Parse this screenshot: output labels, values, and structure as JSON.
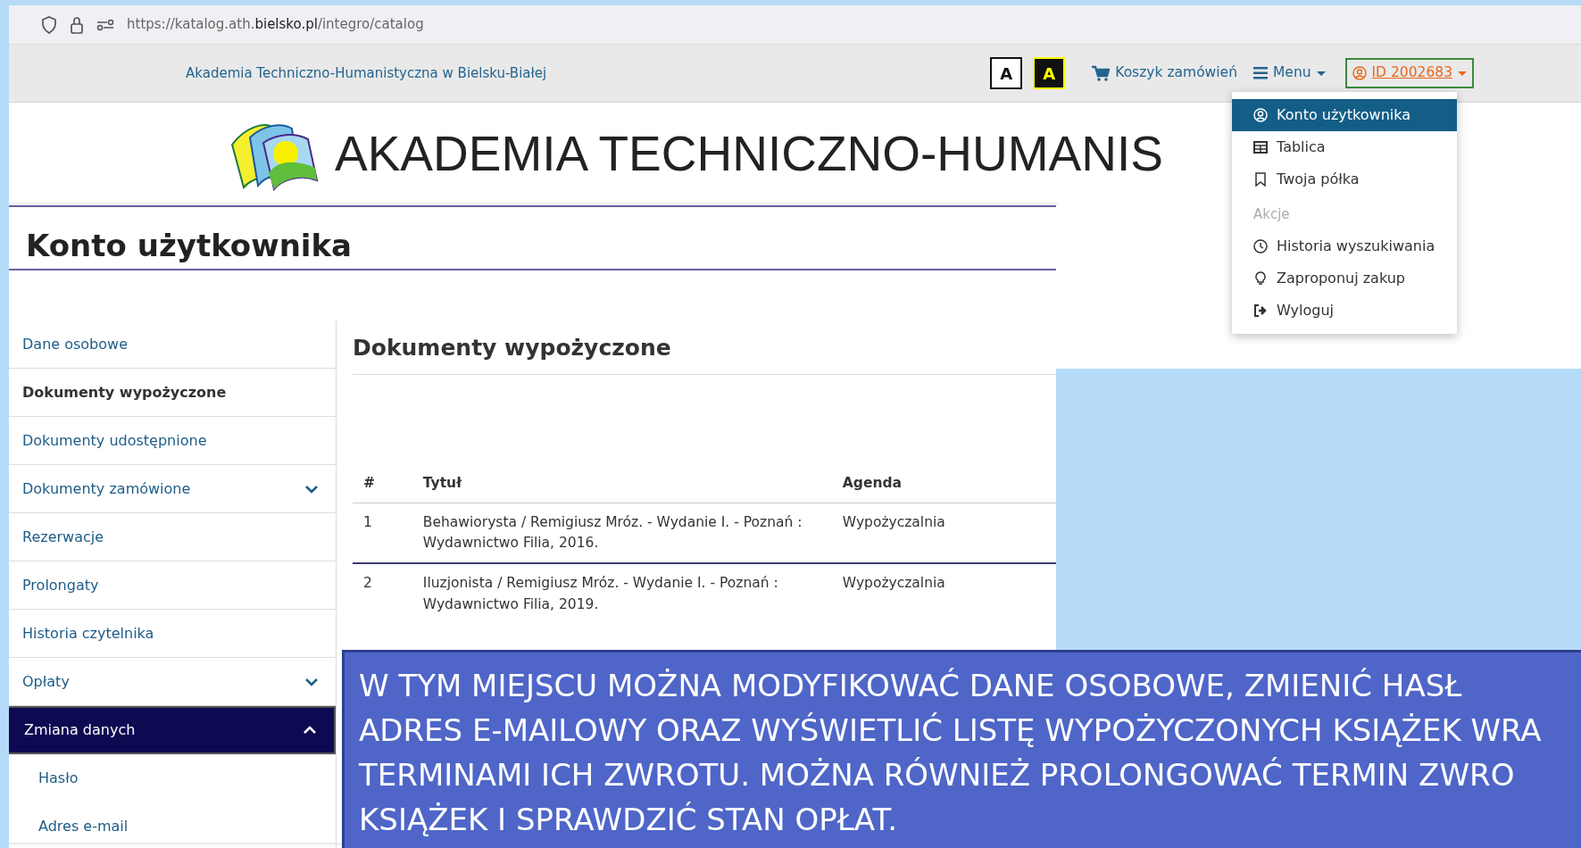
{
  "browser": {
    "url_parts": [
      "https://katalog.ath.",
      "bielsko.pl",
      "/integro/catalog"
    ]
  },
  "navbar": {
    "institution": "Akademia Techniczno-Humanistyczna w Bielsku-Białej",
    "contrast_buttons": [
      {
        "label": "A",
        "kind": "normal"
      },
      {
        "label": "A",
        "kind": "high"
      }
    ],
    "cart": "Koszyk zamówień",
    "menu": "Menu",
    "user": "ID 2002683"
  },
  "user_menu": {
    "items": [
      {
        "kind": "item",
        "label": "Konto użytkownika",
        "selected": true
      },
      {
        "kind": "item",
        "label": "Tablica",
        "selected": false
      },
      {
        "kind": "item",
        "label": "Twoja półka",
        "selected": false
      },
      {
        "kind": "header",
        "label": "Akcje"
      },
      {
        "kind": "item",
        "label": "Historia wyszukiwania",
        "selected": false
      },
      {
        "kind": "item",
        "label": "Zaproponuj zakup",
        "selected": false
      },
      {
        "kind": "item",
        "label": "Wyloguj",
        "selected": false
      }
    ]
  },
  "banner": {
    "title": "AKADEMIA TECHNICZNO-HUMANIS"
  },
  "account": {
    "title": "Konto użytkownika",
    "sidebar": {
      "items": [
        {
          "label": "Dane osobowe",
          "selected": false,
          "highlighted": false
        },
        {
          "label": "Dokumenty wypożyczone",
          "selected": true,
          "highlighted": false
        },
        {
          "label": "Dokumenty udostępnione",
          "selected": false,
          "highlighted": false
        },
        {
          "label": "Dokumenty zamówione",
          "selected": false,
          "highlighted": false,
          "expanded": false
        },
        {
          "label": "Rezerwacje",
          "selected": false,
          "highlighted": false
        },
        {
          "label": "Prolongaty",
          "selected": false,
          "highlighted": false
        },
        {
          "label": "Historia czytelnika",
          "selected": false,
          "highlighted": false
        },
        {
          "label": "Opłaty",
          "selected": false,
          "highlighted": false,
          "expanded": false
        },
        {
          "label": "Zmiana danych",
          "selected": false,
          "highlighted": true,
          "expanded": true,
          "children": [
            {
              "label": "Hasło"
            },
            {
              "label": "Adres e-mail"
            }
          ]
        }
      ]
    },
    "content": {
      "heading": "Dokumenty wypożyczone",
      "table": {
        "columns": [
          "#",
          "Tytuł",
          "Agenda"
        ],
        "rows": [
          {
            "cells": [
              "1",
              "Behawiorysta / Remigiusz Mróz. - Wydanie I. - Poznań : Wydawnictwo Filia, 2016.",
              "Wypożyczalnia"
            ]
          },
          {
            "cells": [
              "2",
              "Iluzjonista / Remigiusz Mróz. - Wydanie I. - Poznań : Wydawnictwo Filia, 2019.",
              "Wypożyczalnia"
            ]
          }
        ]
      }
    }
  },
  "callout": {
    "lines": [
      "W TYM MIEJSCU MOŻNA MODYFIKOWAĆ DANE OSOBOWE, ZMIENIĆ HASŁ",
      "ADRES E-MAILOWY ORAZ WYŚWIETLIĆ LISTĘ WYPOŻYCZONYCH KSIĄŻEK WRA",
      "TERMINAMI ICH ZWROTU. MOŻNA RÓWNIEŻ PROLONGOWAĆ TERMIN ZWRO",
      "KSIĄŻEK I SPRAWDZIĆ STAN OPŁAT."
    ]
  }
}
